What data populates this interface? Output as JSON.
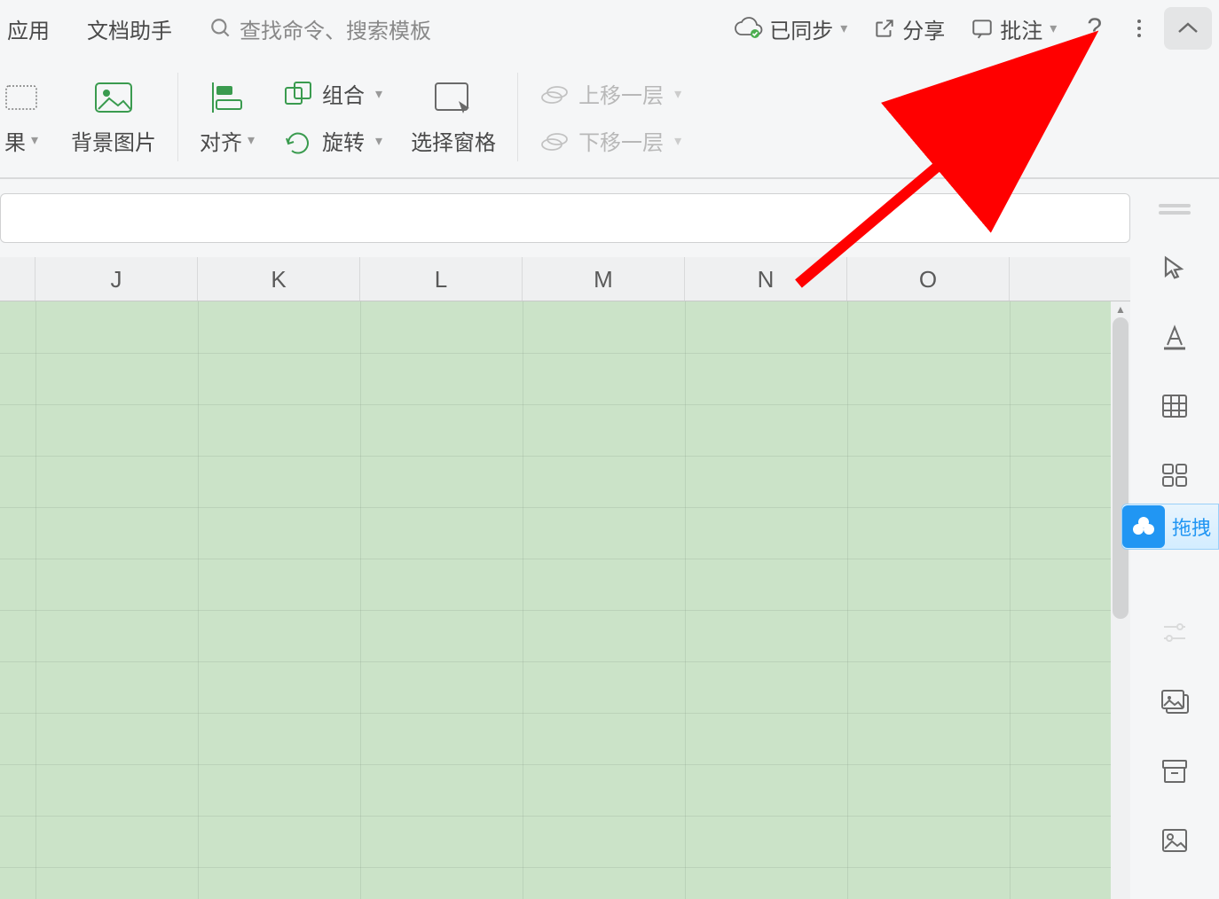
{
  "topbar": {
    "app": "应用",
    "doc_helper": "文档助手",
    "search_placeholder": "查找命令、搜索模板",
    "sync_status": "已同步",
    "share": "分享",
    "annotate": "批注"
  },
  "ribbon": {
    "effect": "果",
    "bg_image": "背景图片",
    "align": "对齐",
    "group": "组合",
    "rotate": "旋转",
    "select_pane": "选择窗格",
    "move_up": "上移一层",
    "move_down": "下移一层"
  },
  "columns": [
    "J",
    "K",
    "L",
    "M",
    "N",
    "O"
  ],
  "sidebar": {
    "baidu_label": "拖拽"
  },
  "colors": {
    "cell_bg": "#cbe3c8",
    "arrow": "#ff0000",
    "accent_blue": "#2196f3"
  }
}
